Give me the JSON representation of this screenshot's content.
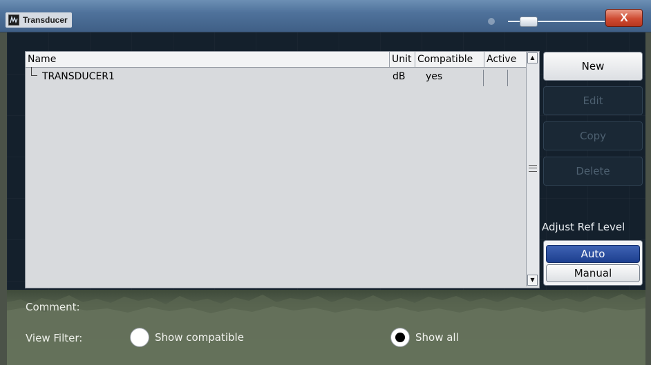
{
  "window": {
    "title": "Transducer",
    "close_label": "X"
  },
  "table": {
    "columns": [
      "Name",
      "Unit",
      "Compatible",
      "Active"
    ],
    "rows": [
      {
        "name": "TRANSDUCER1",
        "unit": "dB",
        "compatible": "yes",
        "active": ""
      }
    ]
  },
  "actions": {
    "new": "New",
    "edit": "Edit",
    "copy": "Copy",
    "delete": "Delete"
  },
  "ref_level": {
    "label": "Adjust Ref Level",
    "options": [
      "Auto",
      "Manual"
    ],
    "selected": "Auto"
  },
  "comment": {
    "label": "Comment:"
  },
  "view_filter": {
    "label": "View Filter:",
    "options": [
      "Show compatible",
      "Show all"
    ],
    "selected": "Show all"
  },
  "colors": {
    "accent_selected": "#1d3f8f",
    "close_button": "#cf4b32",
    "disabled_text": "#4d6070"
  }
}
